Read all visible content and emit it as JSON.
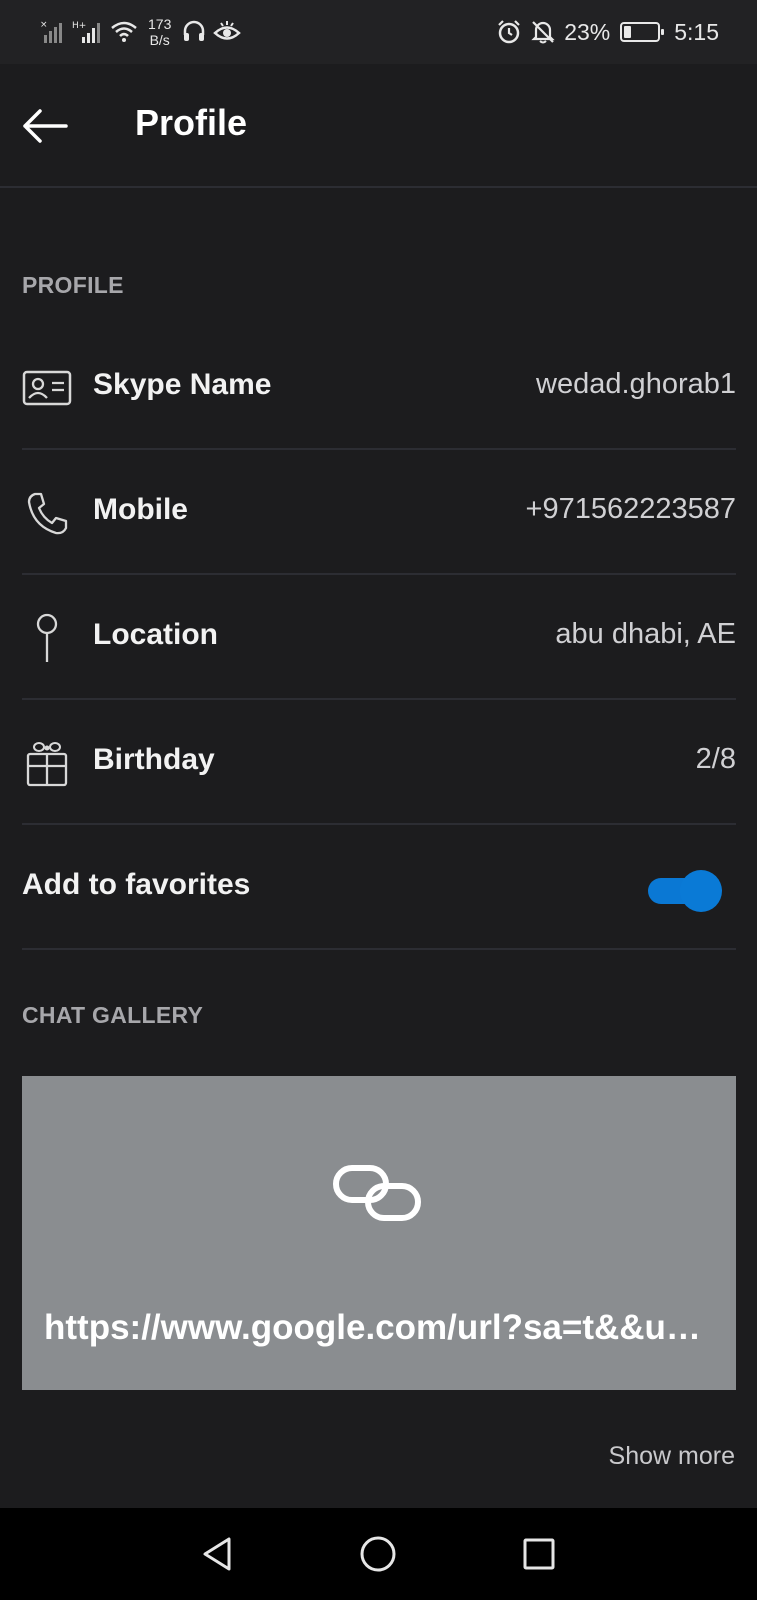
{
  "status_bar": {
    "network_speed_value": "173",
    "network_speed_unit": "B/s",
    "battery_percent_text": "23%",
    "battery_level": 0.23,
    "time": "5:15"
  },
  "header": {
    "title": "Profile"
  },
  "profile_section": {
    "heading": "PROFILE",
    "items": [
      {
        "label": "Skype Name",
        "value": "wedad.ghorab1",
        "icon": "contact-card-icon"
      },
      {
        "label": "Mobile",
        "value": "+971562223587",
        "icon": "phone-icon"
      },
      {
        "label": "Location",
        "value": "abu dhabi, AE",
        "icon": "location-pin-icon"
      },
      {
        "label": "Birthday",
        "value": "2/8",
        "icon": "gift-icon"
      }
    ]
  },
  "favorites": {
    "label": "Add to favorites",
    "enabled": true
  },
  "chat_gallery": {
    "heading": "CHAT GALLERY",
    "link_url": "https://www.google.com/url?sa=t&&u…",
    "show_more_label": "Show more"
  },
  "colors": {
    "background": "#1c1c1e",
    "accent": "#0a78d4",
    "gallery_card": "#8a8d90"
  }
}
